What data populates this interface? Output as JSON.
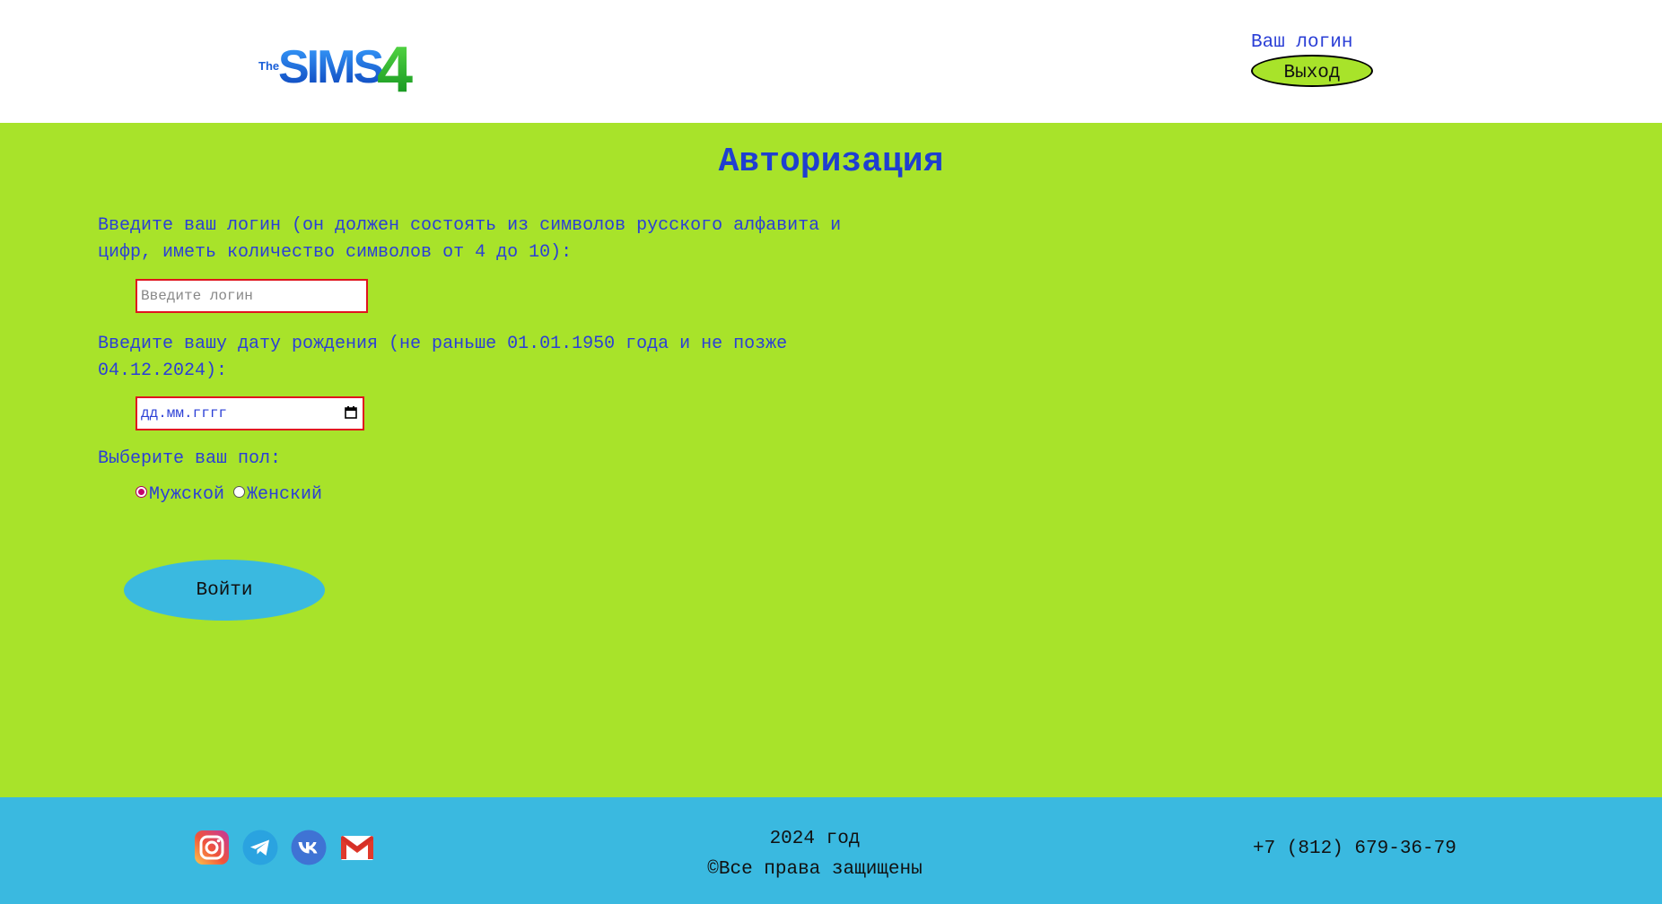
{
  "header": {
    "logo_alt": "The Sims 4",
    "user_login_link": "Ваш логин",
    "logout_label": "Выход"
  },
  "main": {
    "title": "Авторизация",
    "login_label": "Введите ваш логин (он должен состоять из символов русского алфавита и цифр, иметь количество символов от 4 до 10):",
    "login_placeholder": "Введите логин",
    "birth_label": "Введите вашу дату рождения (не раньше 01.01.1950 года и не позже 04.12.2024):",
    "birth_placeholder": "дд.мм.гггг",
    "gender_label": "Выберите ваш пол:",
    "gender_options": [
      {
        "label": "Мужской",
        "checked": true
      },
      {
        "label": "Женский",
        "checked": false
      }
    ],
    "submit_label": "Войти"
  },
  "footer": {
    "socials": [
      "instagram-icon",
      "telegram-icon",
      "vk-icon",
      "gmail-icon"
    ],
    "year": "2024 год",
    "copyright": "©Все права защищены",
    "phone": "+7 (812) 679-36-79"
  },
  "colors": {
    "accent_green": "#a8e32a",
    "footer_blue": "#3ab9e0",
    "text_blue": "#2b3fd6",
    "field_border": "#e0141e"
  }
}
